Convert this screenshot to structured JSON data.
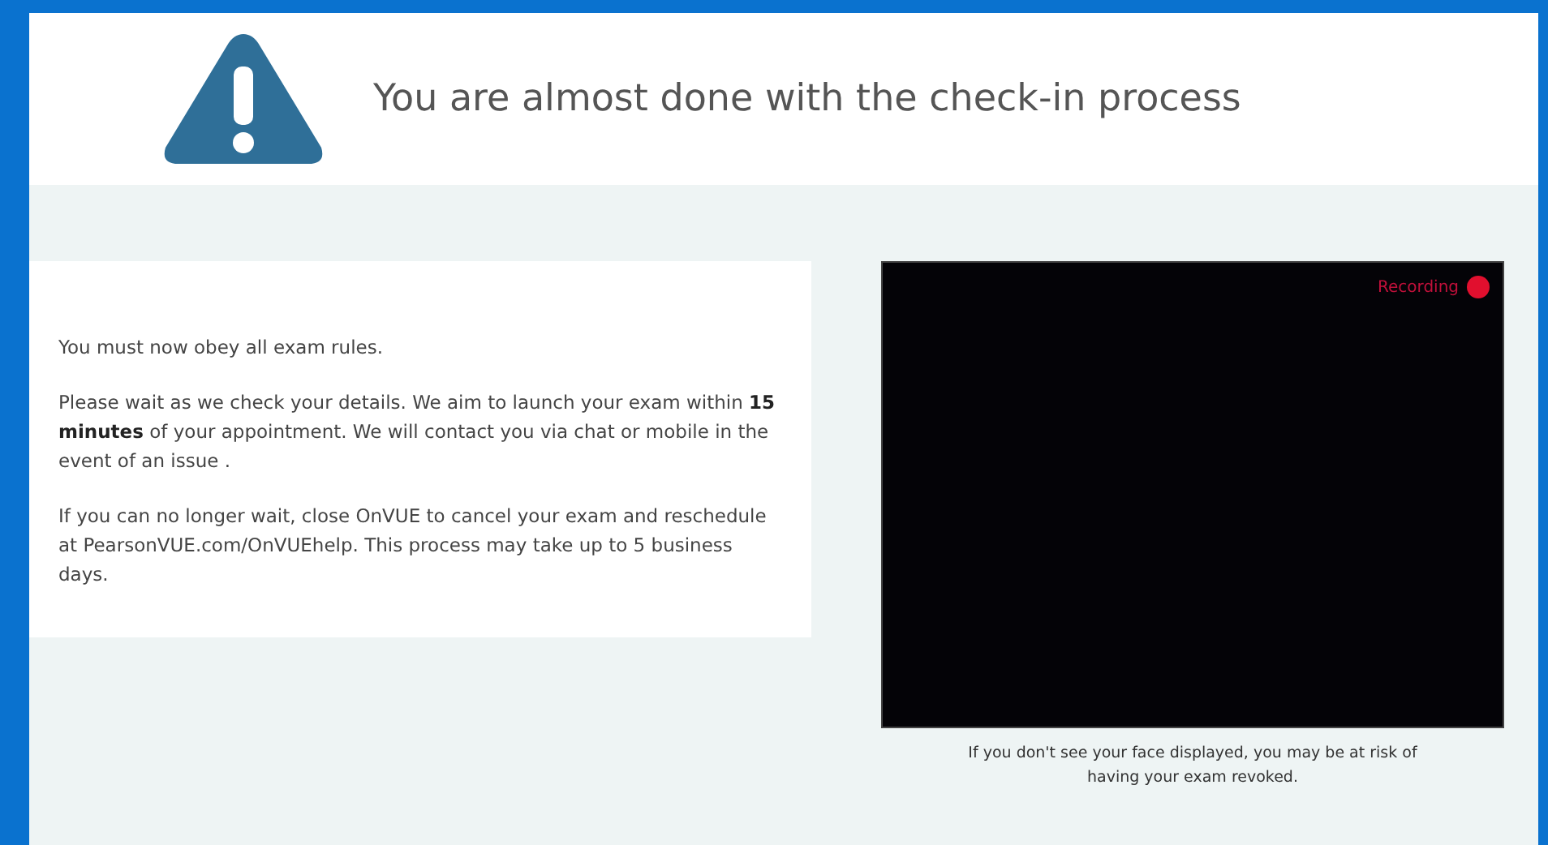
{
  "header": {
    "title": "You are almost done with the check-in process"
  },
  "instructions": {
    "paragraphs": [
      "You must now obey all exam rules.",
      "Please wait as we check your details. We aim to launch your exam within **15 minutes** of your appointment. We will contact you via chat or mobile in the event of an issue .",
      "If you can no longer wait, close OnVUE to cancel your exam and reschedule at PearsonVUE.com/OnVUEhelp. This process may take up to 5 business days."
    ]
  },
  "camera": {
    "recording": true,
    "indicator_label": "Recording",
    "caption": "If you don't see your face displayed, you may be at risk of having your exam revoked."
  }
}
